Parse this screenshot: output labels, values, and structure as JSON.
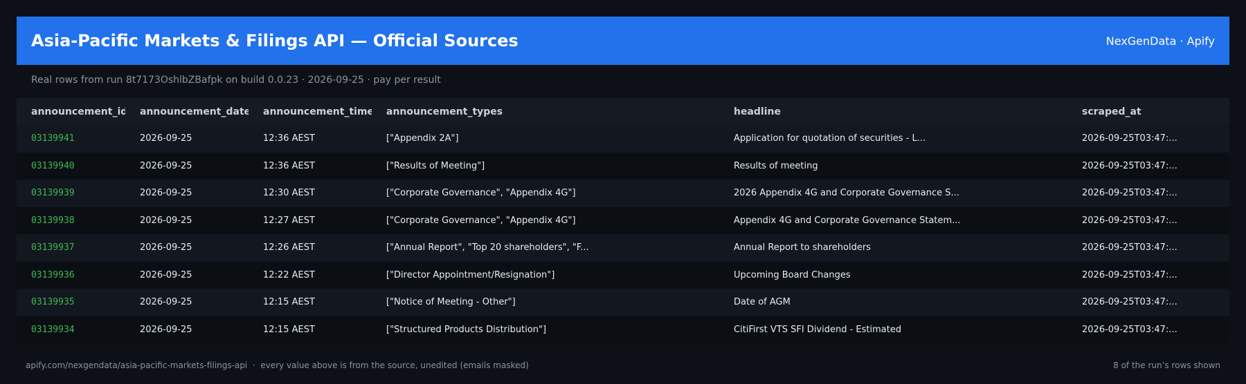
{
  "header": {
    "title": "Asia-Pacific Markets & Filings API — Official Sources",
    "brand": "NexGenData · Apify"
  },
  "subtitle": "Real rows from run 8t7173OshlbZBafpk on build 0.0.23 · 2026-09-25 · pay per result",
  "colors": {
    "header_bg": "#2272eb",
    "page_bg": "#0d1117",
    "id_text": "#3fb950",
    "muted_text": "#8b949e"
  },
  "table": {
    "columns": [
      "announcement_id",
      "announcement_date",
      "announcement_time",
      "announcement_types",
      "headline",
      "scraped_at"
    ],
    "rows": [
      [
        "03139941",
        "2026-09-25",
        "12:36 AEST",
        "[\"Appendix 2A\"]",
        "Application for quotation of securities - L...",
        "2026-09-25T03:47:..."
      ],
      [
        "03139940",
        "2026-09-25",
        "12:36 AEST",
        "[\"Results of Meeting\"]",
        "Results of meeting",
        "2026-09-25T03:47:..."
      ],
      [
        "03139939",
        "2026-09-25",
        "12:30 AEST",
        "[\"Corporate Governance\", \"Appendix 4G\"]",
        "2026 Appendix 4G and Corporate Governance S...",
        "2026-09-25T03:47:..."
      ],
      [
        "03139938",
        "2026-09-25",
        "12:27 AEST",
        "[\"Corporate Governance\", \"Appendix 4G\"]",
        "Appendix 4G and Corporate Governance Statem...",
        "2026-09-25T03:47:..."
      ],
      [
        "03139937",
        "2026-09-25",
        "12:26 AEST",
        "[\"Annual Report\", \"Top 20 shareholders\", \"F...",
        "Annual Report to shareholders",
        "2026-09-25T03:47:..."
      ],
      [
        "03139936",
        "2026-09-25",
        "12:22 AEST",
        "[\"Director Appointment/Resignation\"]",
        "Upcoming Board Changes",
        "2026-09-25T03:47:..."
      ],
      [
        "03139935",
        "2026-09-25",
        "12:15 AEST",
        "[\"Notice of Meeting - Other\"]",
        "Date of AGM",
        "2026-09-25T03:47:..."
      ],
      [
        "03139934",
        "2026-09-25",
        "12:15 AEST",
        "[\"Structured Products Distribution\"]",
        "CitiFirst VTS SFI Dividend - Estimated",
        "2026-09-25T03:47:..."
      ]
    ]
  },
  "footer": {
    "left": "apify.com/nexgendata/asia-pacific-markets-filings-api  ·  every value above is from the source, unedited (emails masked)",
    "right": "8 of the run’s rows shown"
  }
}
